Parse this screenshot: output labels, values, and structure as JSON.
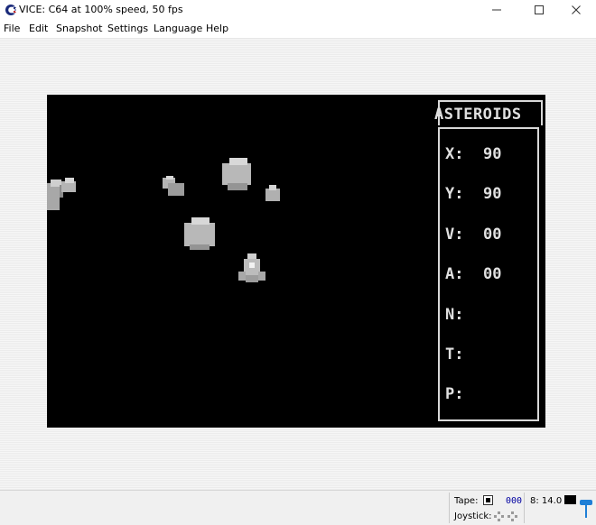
{
  "window": {
    "title": "VICE: C64 at 100% speed, 50 fps"
  },
  "menu": [
    "File",
    "Edit",
    "Snapshot",
    "Settings",
    "Language",
    "Help"
  ],
  "game": {
    "panel_title": "ASTEROIDS",
    "stats": [
      {
        "label": "X:",
        "value": "90"
      },
      {
        "label": "Y:",
        "value": "90"
      },
      {
        "label": "V:",
        "value": "00"
      },
      {
        "label": "A:",
        "value": "00"
      },
      {
        "label": "N:",
        "value": ""
      },
      {
        "label": "T:",
        "value": ""
      },
      {
        "label": "P:",
        "value": ""
      }
    ]
  },
  "status": {
    "tape_label": "Tape:",
    "tape_counter": "000",
    "drive_label": "8: 14.0",
    "joystick_label": "Joystick:"
  },
  "colors": {
    "screen_bg": "#000000",
    "sprite_gray": "#b0b0b0",
    "text_light": "#e0e0e0",
    "drive_led": "#000000",
    "accent_blue": "#1f7fd6"
  },
  "icons": {
    "app": "commodore-logo-icon",
    "minimize": "minimize-icon",
    "maximize": "maximize-icon",
    "close": "close-icon",
    "tape_stop": "tape-stop-icon",
    "joystick": "joystick-icon",
    "speaker": "volume-slider-icon"
  }
}
